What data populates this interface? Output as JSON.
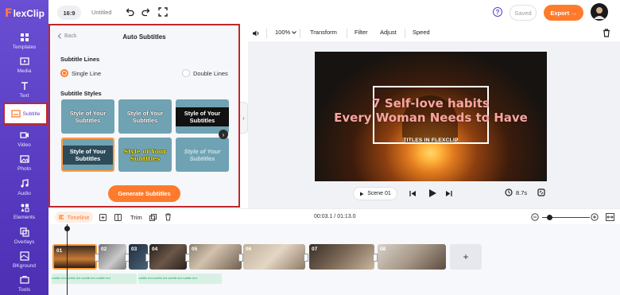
{
  "app": {
    "name": "FlexClip",
    "logo_mark": "F",
    "logo_word": "lexClip"
  },
  "sidebar": {
    "items": [
      {
        "label": "Templates",
        "icon": "templates-icon"
      },
      {
        "label": "Media",
        "icon": "media-icon"
      },
      {
        "label": "Text",
        "icon": "text-icon"
      },
      {
        "label": "Subtitle",
        "icon": "subtitle-icon",
        "active": true
      },
      {
        "label": "Video",
        "icon": "video-icon"
      },
      {
        "label": "Photo",
        "icon": "photo-icon"
      },
      {
        "label": "Audio",
        "icon": "audio-icon"
      },
      {
        "label": "Elements",
        "icon": "elements-icon"
      },
      {
        "label": "Overlays",
        "icon": "overlays-icon"
      },
      {
        "label": "BKground",
        "icon": "background-icon"
      },
      {
        "label": "Tools",
        "icon": "tools-icon"
      }
    ]
  },
  "topbar": {
    "ratio": "16:9",
    "project_name": "Untitled",
    "help": "?",
    "saved_label": "Saved",
    "export_label": "Export →"
  },
  "panel": {
    "back_label": "Back",
    "title": "Auto Subtitles",
    "lines_title": "Subtitle Lines",
    "single_line": "Single Line",
    "double_lines": "Double Lines",
    "styles_title": "Subtitle Styles",
    "style_sample": "Style of Your Subtitles",
    "generate_label": "Generate Subtitles"
  },
  "toolbar": {
    "zoom": "100%",
    "transform": "Transform",
    "filter": "Filter",
    "adjust": "Adjust",
    "speed": "Speed"
  },
  "preview": {
    "title_line1": "7 Self-love habits",
    "title_line2": "Every Woman Needs to Have",
    "caption": "TITLES IN FLEXCLIP",
    "scene_label": "Scene 01",
    "duration": "8.7s"
  },
  "timeline": {
    "label": "Timeline",
    "trim_label": "Trim",
    "time": "00:03.1 / 01:13.0",
    "clips": [
      "01",
      "02",
      "03",
      "04",
      "05",
      "06",
      "07",
      "08"
    ],
    "add_label": "+",
    "subtitle_snippet": "subtitle text subtitle text subtitle text subtitle text"
  },
  "colors": {
    "accent": "#ff7b2c",
    "brand": "#5b3ec4",
    "highlight_border": "#c0282a"
  }
}
